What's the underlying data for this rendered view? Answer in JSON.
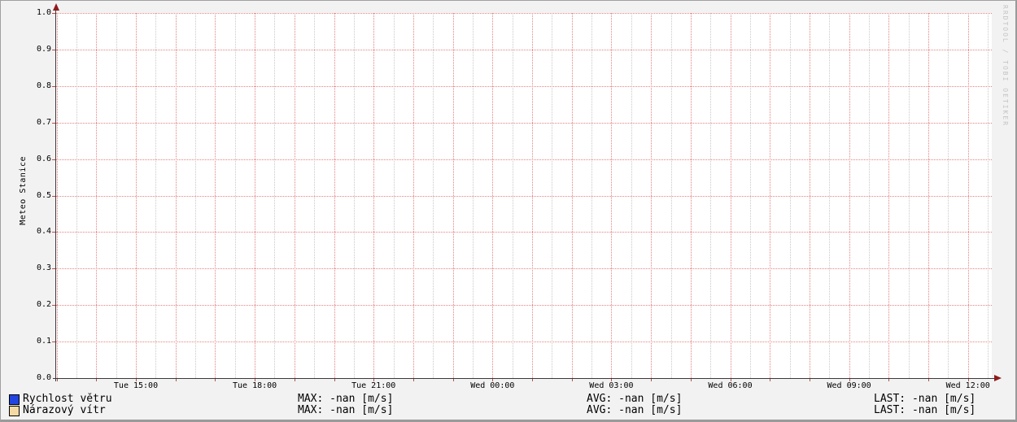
{
  "watermark": "RRDTOOL / TOBI OETIKER",
  "y_axis": {
    "title": "Meteo Stanice",
    "tick_labels": [
      "1.0",
      "0.9",
      "0.8",
      "0.7",
      "0.6",
      "0.5",
      "0.4",
      "0.3",
      "0.2",
      "0.1",
      "0.0"
    ]
  },
  "x_axis": {
    "tick_labels": [
      "Tue 15:00",
      "Tue 18:00",
      "Tue 21:00",
      "Wed 00:00",
      "Wed 03:00",
      "Wed 06:00",
      "Wed 09:00",
      "Wed 12:00"
    ]
  },
  "legend": {
    "rows": [
      {
        "label": "Rychlost větru",
        "swatch_color": "#2244e0",
        "max": "MAX: -nan [m/s]",
        "avg": "AVG: -nan [m/s]",
        "last": "LAST: -nan [m/s]"
      },
      {
        "label": "Nárazový vítr",
        "swatch_color": "#f3daa4",
        "max": "MAX: -nan [m/s]",
        "avg": "AVG: -nan [m/s]",
        "last": "LAST: -nan [m/s]"
      }
    ]
  },
  "chart_data": {
    "type": "line",
    "title": "",
    "ylabel": "Meteo Stanice",
    "xlabel": "",
    "ylim": [
      0.0,
      1.0
    ],
    "y_tick_step": 0.1,
    "y_tick_labels": [
      "1.0",
      "0.9",
      "0.8",
      "0.7",
      "0.6",
      "0.5",
      "0.4",
      "0.3",
      "0.2",
      "0.1",
      "0.0"
    ],
    "x_tick_labels": [
      "Tue 15:00",
      "Tue 18:00",
      "Tue 21:00",
      "Wed 00:00",
      "Wed 03:00",
      "Wed 06:00",
      "Wed 09:00",
      "Wed 12:00"
    ],
    "grid": true,
    "legend_position": "bottom",
    "series": [
      {
        "name": "Rychlost větru",
        "color": "#2244e0",
        "values": [],
        "max": "-nan [m/s]",
        "avg": "-nan [m/s]",
        "last": "-nan [m/s]"
      },
      {
        "name": "Nárazový vítr",
        "color": "#f3daa4",
        "values": [],
        "max": "-nan [m/s]",
        "avg": "-nan [m/s]",
        "last": "-nan [m/s]"
      }
    ],
    "colors": {
      "grid_major": "#e58383",
      "grid_minor": "#c9c9c9",
      "axis": "#3a3a3a",
      "arrow": "#8f1b1b",
      "plot_background": "#ffffff",
      "canvas_background": "#f2f2f2"
    }
  }
}
